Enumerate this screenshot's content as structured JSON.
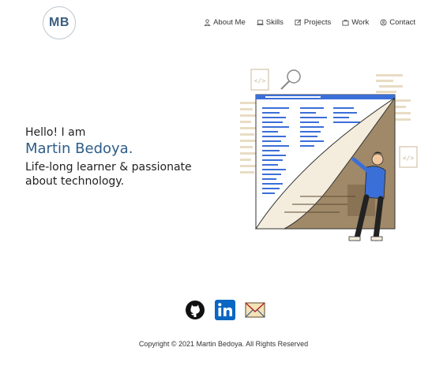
{
  "logo": {
    "text": "MB"
  },
  "nav": {
    "items": [
      {
        "label": "About Me",
        "icon": "user-icon"
      },
      {
        "label": "Skills",
        "icon": "laptop-icon"
      },
      {
        "label": "Projects",
        "icon": "edit-icon"
      },
      {
        "label": "Work",
        "icon": "briefcase-icon"
      },
      {
        "label": "Contact",
        "icon": "contact-icon"
      }
    ]
  },
  "hero": {
    "greeting": "Hello! I am",
    "name": "Martin Bedoya.",
    "tagline": "Life-long learner & passionate about technology."
  },
  "socials": [
    {
      "icon": "github-icon"
    },
    {
      "icon": "linkedin-icon"
    },
    {
      "icon": "mail-icon"
    }
  ],
  "footer": {
    "copyright": "Copyright © 2021 Martin Bedoya. All Rights Reserved"
  },
  "colors": {
    "accent": "#2d5d8a",
    "linkedin": "#0a66c2",
    "illustration_blue": "#3b6fd8"
  }
}
